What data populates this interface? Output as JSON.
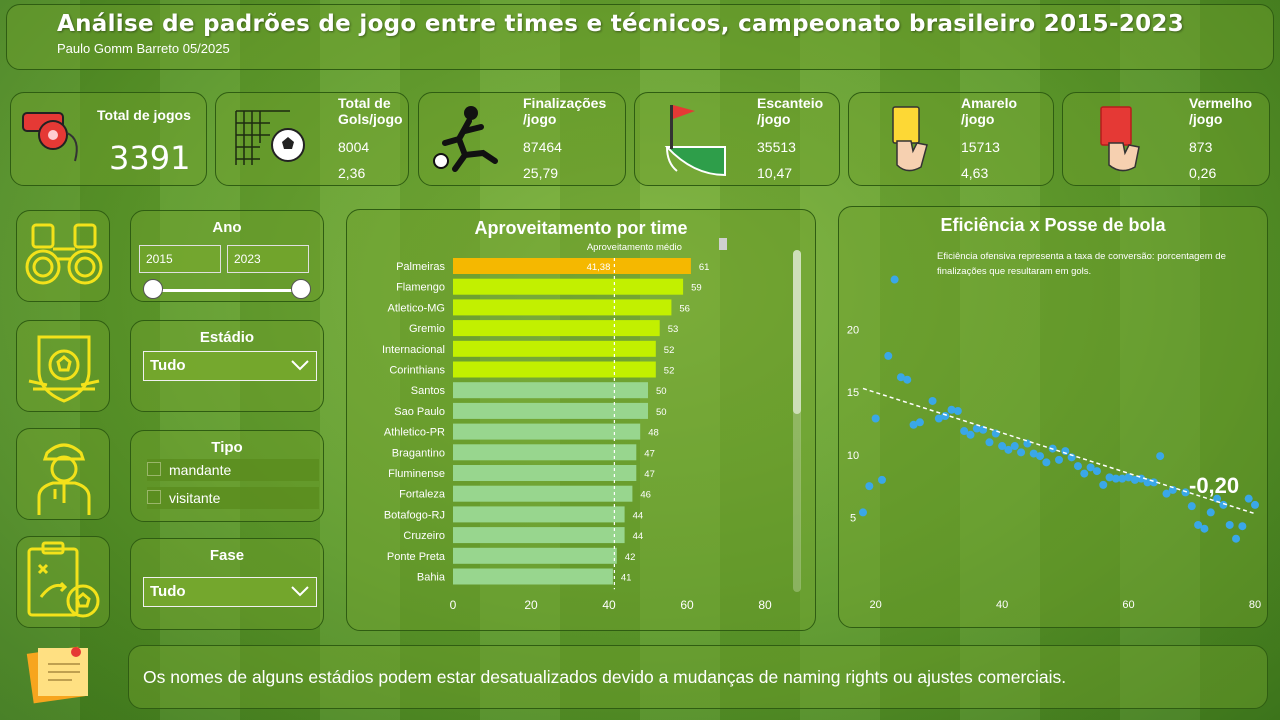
{
  "header": {
    "title": "Análise de padrões de jogo entre times e técnicos, campeonato brasileiro 2015-2023",
    "author": "Paulo Gomm Barreto 05/2025"
  },
  "kpis": {
    "total_jogos": {
      "label": "Total de jogos",
      "value": "3391",
      "icon": "whistle-icon"
    },
    "gols": {
      "label": "Total de Gols/jogo",
      "total": "8004",
      "per_game": "2,36",
      "icon": "ball-in-net-icon"
    },
    "finalizacoes": {
      "label": "Finalizações /jogo",
      "total": "87464",
      "per_game": "25,79",
      "icon": "kicking-player-icon"
    },
    "escanteio": {
      "label": "Escanteio /jogo",
      "total": "35513",
      "per_game": "10,47",
      "icon": "corner-flag-icon"
    },
    "amarelo": {
      "label": "Amarelo /jogo",
      "total": "15713",
      "per_game": "4,63",
      "icon": "yellow-card-icon"
    },
    "vermelho": {
      "label": "Vermelho /jogo",
      "total": "873",
      "per_game": "0,26",
      "icon": "red-card-icon"
    }
  },
  "filters": {
    "ano": {
      "label": "Ano",
      "from": "2015",
      "to": "2023",
      "icon": "binoculars-icon"
    },
    "estadio": {
      "label": "Estádio",
      "value": "Tudo",
      "icon": "stadium-badge-icon"
    },
    "tipo": {
      "label": "Tipo",
      "options": [
        "mandante",
        "visitante"
      ],
      "icon": "coach-icon"
    },
    "fase": {
      "label": "Fase",
      "value": "Tudo",
      "icon": "tactics-board-icon"
    }
  },
  "note": {
    "text": "Os nomes de alguns estádios podem estar desatualizados devido a mudanças de naming rights ou ajustes comerciais.",
    "icon": "sticky-note-icon"
  },
  "chart_data": [
    {
      "type": "bar",
      "title": "Aproveitamento por time",
      "reference_line": {
        "label": "Aproveitamento médio",
        "value": 41.38,
        "value_label": "41,38"
      },
      "categories": [
        "Palmeiras",
        "Flamengo",
        "Atletico-MG",
        "Gremio",
        "Internacional",
        "Corinthians",
        "Santos",
        "Sao Paulo",
        "Athletico-PR",
        "Bragantino",
        "Fluminense",
        "Fortaleza",
        "Botafogo-RJ",
        "Cruzeiro",
        "Ponte Preta",
        "Bahia"
      ],
      "values": [
        61,
        59,
        56,
        53,
        52,
        52,
        50,
        50,
        48,
        47,
        47,
        46,
        44,
        44,
        42,
        41
      ],
      "colors": [
        "#f5b800",
        "#c2f000",
        "#c2f000",
        "#c2f000",
        "#c2f000",
        "#c2f000",
        "#98d68e",
        "#98d68e",
        "#98d68e",
        "#98d68e",
        "#98d68e",
        "#98d68e",
        "#98d68e",
        "#98d68e",
        "#98d68e",
        "#98d68e"
      ],
      "xlim": [
        0,
        80
      ],
      "xticks": [
        "0",
        "20",
        "40",
        "60",
        "80"
      ]
    },
    {
      "type": "scatter",
      "title": "Eficiência x Posse de bola",
      "subtitle": "Eficiência ofensiva representa a taxa de conversão: porcentagem de finalizações que resultaram em gols.",
      "correlation": "-0,20",
      "xlim": [
        18,
        80
      ],
      "ylim": [
        2,
        25
      ],
      "xticks": [
        "20",
        "40",
        "60",
        "80"
      ],
      "yticks": [
        "5",
        "10",
        "15",
        "20"
      ],
      "color": "#3aa7e8",
      "trend": {
        "x": [
          18,
          80
        ],
        "y": [
          15.3,
          5.3
        ]
      },
      "points": [
        {
          "x": 18,
          "y": 5.4
        },
        {
          "x": 19,
          "y": 7.5
        },
        {
          "x": 20,
          "y": 12.9
        },
        {
          "x": 21,
          "y": 8.0
        },
        {
          "x": 22,
          "y": 17.9
        },
        {
          "x": 23,
          "y": 24.0
        },
        {
          "x": 24,
          "y": 16.2
        },
        {
          "x": 25,
          "y": 16.0
        },
        {
          "x": 26,
          "y": 12.4
        },
        {
          "x": 27,
          "y": 12.6
        },
        {
          "x": 29,
          "y": 14.3
        },
        {
          "x": 30,
          "y": 12.9
        },
        {
          "x": 31,
          "y": 13.1
        },
        {
          "x": 32,
          "y": 13.6
        },
        {
          "x": 33,
          "y": 13.5
        },
        {
          "x": 34,
          "y": 11.9
        },
        {
          "x": 35,
          "y": 11.6
        },
        {
          "x": 36,
          "y": 12.1
        },
        {
          "x": 37,
          "y": 12.0
        },
        {
          "x": 38,
          "y": 11.0
        },
        {
          "x": 39,
          "y": 11.7
        },
        {
          "x": 40,
          "y": 10.7
        },
        {
          "x": 41,
          "y": 10.4
        },
        {
          "x": 42,
          "y": 10.7
        },
        {
          "x": 43,
          "y": 10.2
        },
        {
          "x": 44,
          "y": 10.9
        },
        {
          "x": 45,
          "y": 10.1
        },
        {
          "x": 46,
          "y": 9.9
        },
        {
          "x": 47,
          "y": 9.4
        },
        {
          "x": 48,
          "y": 10.5
        },
        {
          "x": 49,
          "y": 9.6
        },
        {
          "x": 50,
          "y": 10.3
        },
        {
          "x": 51,
          "y": 9.8
        },
        {
          "x": 52,
          "y": 9.1
        },
        {
          "x": 53,
          "y": 8.5
        },
        {
          "x": 54,
          "y": 9.0
        },
        {
          "x": 55,
          "y": 8.7
        },
        {
          "x": 56,
          "y": 7.6
        },
        {
          "x": 57,
          "y": 8.2
        },
        {
          "x": 58,
          "y": 8.1
        },
        {
          "x": 59,
          "y": 8.1
        },
        {
          "x": 60,
          "y": 8.2
        },
        {
          "x": 61,
          "y": 8.0
        },
        {
          "x": 62,
          "y": 8.1
        },
        {
          "x": 63,
          "y": 7.8
        },
        {
          "x": 64,
          "y": 7.8
        },
        {
          "x": 65,
          "y": 9.9
        },
        {
          "x": 66,
          "y": 6.9
        },
        {
          "x": 67,
          "y": 7.2
        },
        {
          "x": 69,
          "y": 7.0
        },
        {
          "x": 70,
          "y": 5.9
        },
        {
          "x": 71,
          "y": 4.4
        },
        {
          "x": 72,
          "y": 4.1
        },
        {
          "x": 73,
          "y": 5.4
        },
        {
          "x": 74,
          "y": 6.5
        },
        {
          "x": 75,
          "y": 6.0
        },
        {
          "x": 76,
          "y": 4.4
        },
        {
          "x": 77,
          "y": 3.3
        },
        {
          "x": 78,
          "y": 4.3
        },
        {
          "x": 79,
          "y": 6.5
        },
        {
          "x": 80,
          "y": 6.0
        }
      ]
    }
  ]
}
